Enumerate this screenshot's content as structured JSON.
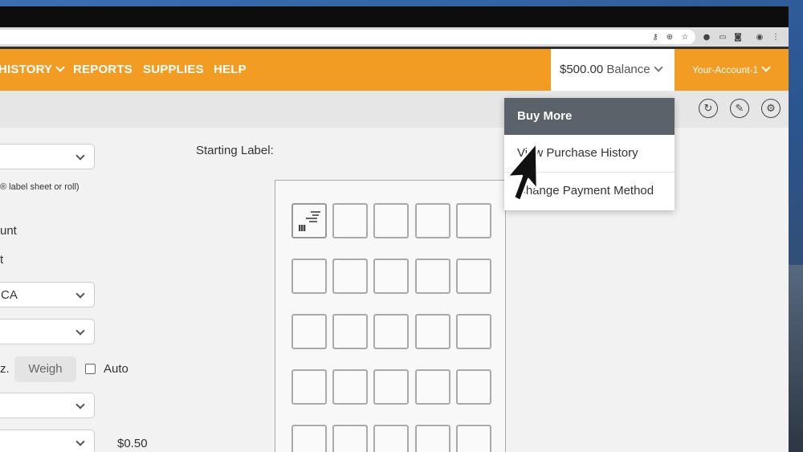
{
  "nav": {
    "items": [
      {
        "label": "HISTORY",
        "dropdown": true
      },
      {
        "label": "REPORTS",
        "dropdown": false
      },
      {
        "label": "SUPPLIES",
        "dropdown": false
      },
      {
        "label": "HELP",
        "dropdown": false
      }
    ],
    "balance": {
      "amount": "$500.00",
      "label": "Balance"
    },
    "account": "Your-Account-1"
  },
  "balance_menu": {
    "header": "Buy More",
    "items": [
      "View Purchase History",
      "Change Payment Method"
    ]
  },
  "form": {
    "sheet_hint": "® label sheet or roll)",
    "frag_unt": "unt",
    "frag_t": "t",
    "ca_value": "CA",
    "oz_suffix": "z.",
    "weigh_label": "Weigh",
    "auto_label": "Auto",
    "price": "$0.50",
    "starting_label": "Starting Label:"
  },
  "label_sheet": {
    "columns": 5,
    "rows_visible": 5,
    "selected_index": 0
  },
  "colors": {
    "nav_bg": "#f39c24",
    "menu_header_bg": "#5c6269"
  },
  "icons": {
    "toolbar": [
      "refresh-icon",
      "eraser-icon",
      "settings-icon"
    ]
  }
}
